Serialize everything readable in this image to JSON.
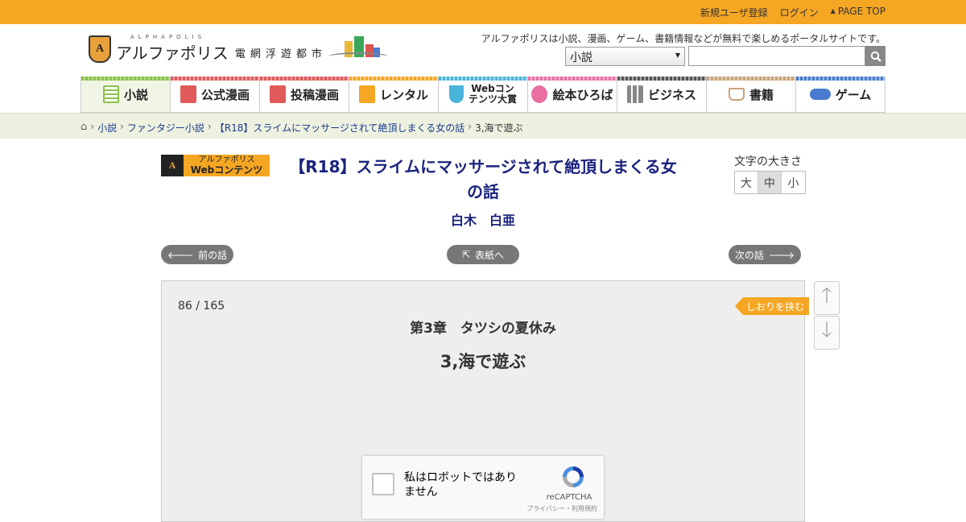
{
  "topbar": {
    "register": "新規ユーザ登録",
    "login": "ログイン",
    "page_top": "PAGE TOP"
  },
  "header": {
    "logo_tiny": "ALPHAPOLIS",
    "logo_name": "アルファポリス",
    "logo_sub": "電網浮遊都市",
    "tagline": "アルファポリスは小説、漫画、ゲーム、書籍情報などが無料で楽しめるポータルサイトです。",
    "search_category": "小説",
    "search_value": ""
  },
  "nav": {
    "items": [
      {
        "label": "小説",
        "color": "#8bc34a"
      },
      {
        "label": "公式漫画",
        "color": "#e05a5a"
      },
      {
        "label": "投稿漫画",
        "color": "#e05a5a"
      },
      {
        "label": "レンタル",
        "color": "#f5a623"
      },
      {
        "label": "Webコンテンツ大賞",
        "color": "#4ab3d9"
      },
      {
        "label": "絵本ひろば",
        "color": "#e86fa0"
      },
      {
        "label": "ビジネス",
        "color": "#555555"
      },
      {
        "label": "書籍",
        "color": "#c9a27a"
      },
      {
        "label": "ゲーム",
        "color": "#4a7bd0"
      }
    ]
  },
  "breadcrumb": {
    "items": [
      "小説",
      "ファンタジー小説",
      "【R18】スライムにマッサージされて絶頂しまくる女の話"
    ],
    "current": "3,海で遊ぶ"
  },
  "work": {
    "badge_top": "アルファポリス",
    "badge_bottom": "Webコンテンツ",
    "title": "【R18】スライムにマッサージされて絶頂しまくる女の話",
    "author": "白木　白亜"
  },
  "font_size": {
    "label": "文字の大きさ",
    "large": "大",
    "medium": "中",
    "small": "小"
  },
  "episode_nav": {
    "prev": "前の話",
    "toc": "表紙へ",
    "next": "次の話"
  },
  "content": {
    "page": "86 / 165",
    "chapter": "第3章　タツシの夏休み",
    "episode": "3,海で遊ぶ",
    "bookmark": "しおりを挟む"
  },
  "captcha": {
    "label": "私はロボットではありません",
    "brand": "reCAPTCHA",
    "terms": "プライバシー・利用規約"
  }
}
